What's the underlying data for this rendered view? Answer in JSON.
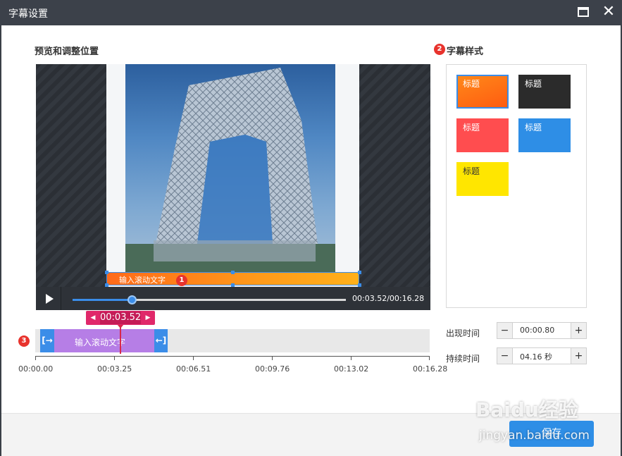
{
  "window": {
    "title": "字幕设置"
  },
  "preview": {
    "section_title": "预览和调整位置",
    "marker": "1",
    "subtitle_text": "输入滚动文字",
    "time": "00:03.52/00:16.28",
    "progress_fraction": 0.216
  },
  "styles": {
    "section_title": "字幕样式",
    "marker": "2",
    "items": [
      {
        "label": "标题",
        "bg": "linear-gradient(160deg,#ff8a1a,#ff5a10)",
        "text": "#ffffff",
        "selected": true
      },
      {
        "label": "标题",
        "bg": "#2b2b2b",
        "text": "#ffffff",
        "selected": false
      },
      {
        "label": "标题",
        "bg": "#ff4d4f",
        "text": "#ffffff",
        "selected": false
      },
      {
        "label": "标题",
        "bg": "#2e8ee6",
        "text": "#ffffff",
        "selected": false
      },
      {
        "label": "标题",
        "bg": "#ffe600",
        "text": "#333333",
        "selected": false
      }
    ]
  },
  "timing": {
    "appear_label": "出现时间",
    "appear_value": "00:00.80",
    "duration_label": "持续时间",
    "duration_value": "04.16 秒",
    "minus": "−",
    "plus": "+"
  },
  "timeline": {
    "marker": "3",
    "clip_text": "输入滚动文字",
    "current_time": "00:03.52",
    "ticks": [
      "00:00.00",
      "00:03.25",
      "00:06.51",
      "00:09.76",
      "00:13.02",
      "00:16.28"
    ]
  },
  "footer": {
    "save_label": "保存"
  },
  "watermark": {
    "line1": "Baidu经验",
    "line2": "jingyan.baidu.com"
  }
}
